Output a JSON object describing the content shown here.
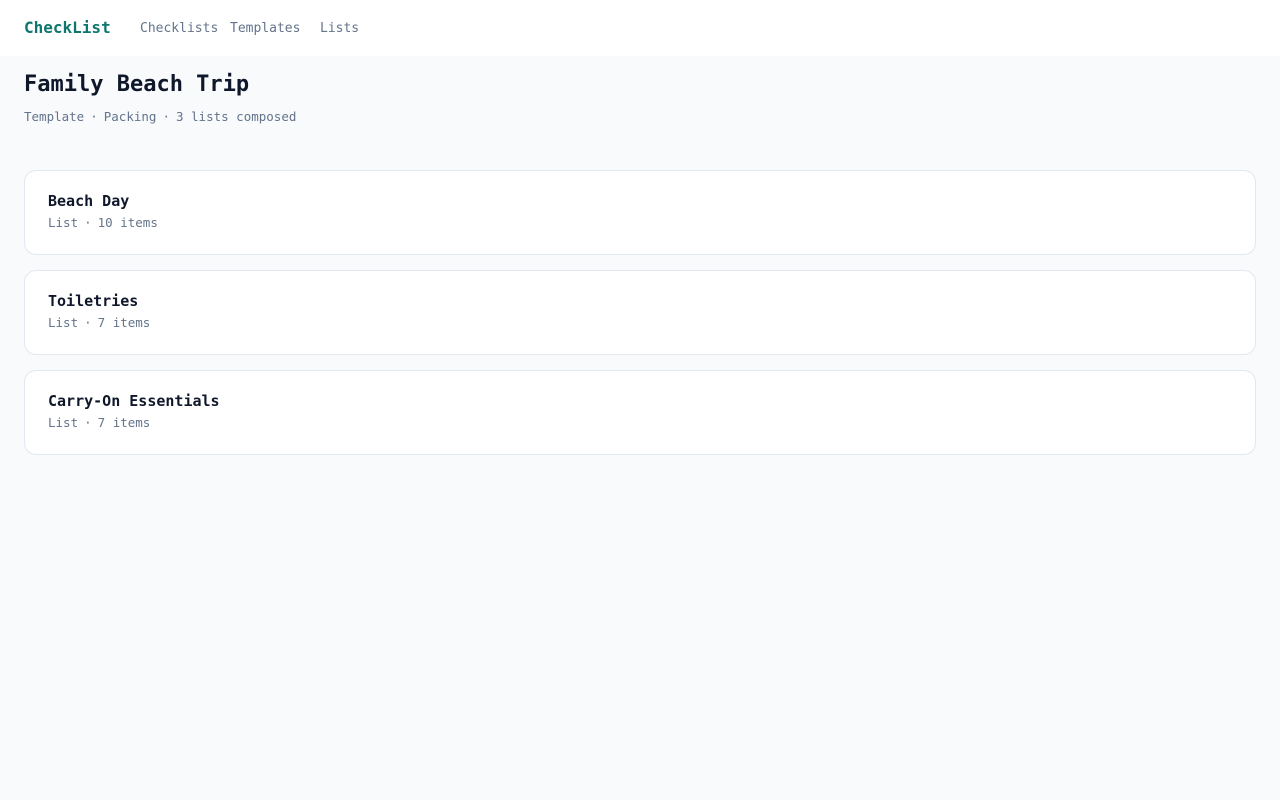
{
  "nav": {
    "brand": "CheckList",
    "links": [
      {
        "label": "Checklists"
      },
      {
        "label": "Templates"
      },
      {
        "label": "Lists"
      }
    ]
  },
  "page": {
    "title": "Family Beach Trip",
    "meta": {
      "kind": "Template",
      "category": "Packing",
      "count_text": "3 lists composed",
      "separator": "·"
    }
  },
  "lists": [
    {
      "title": "Beach Day",
      "type": "List",
      "count_text": "10 items"
    },
    {
      "title": "Toiletries",
      "type": "List",
      "count_text": "7 items"
    },
    {
      "title": "Carry-On Essentials",
      "type": "List",
      "count_text": "7 items"
    }
  ],
  "colors": {
    "brand": "#0f766e",
    "background": "#f8fafc",
    "muted_text": "#64748b",
    "card_border": "#e2e8f0"
  }
}
